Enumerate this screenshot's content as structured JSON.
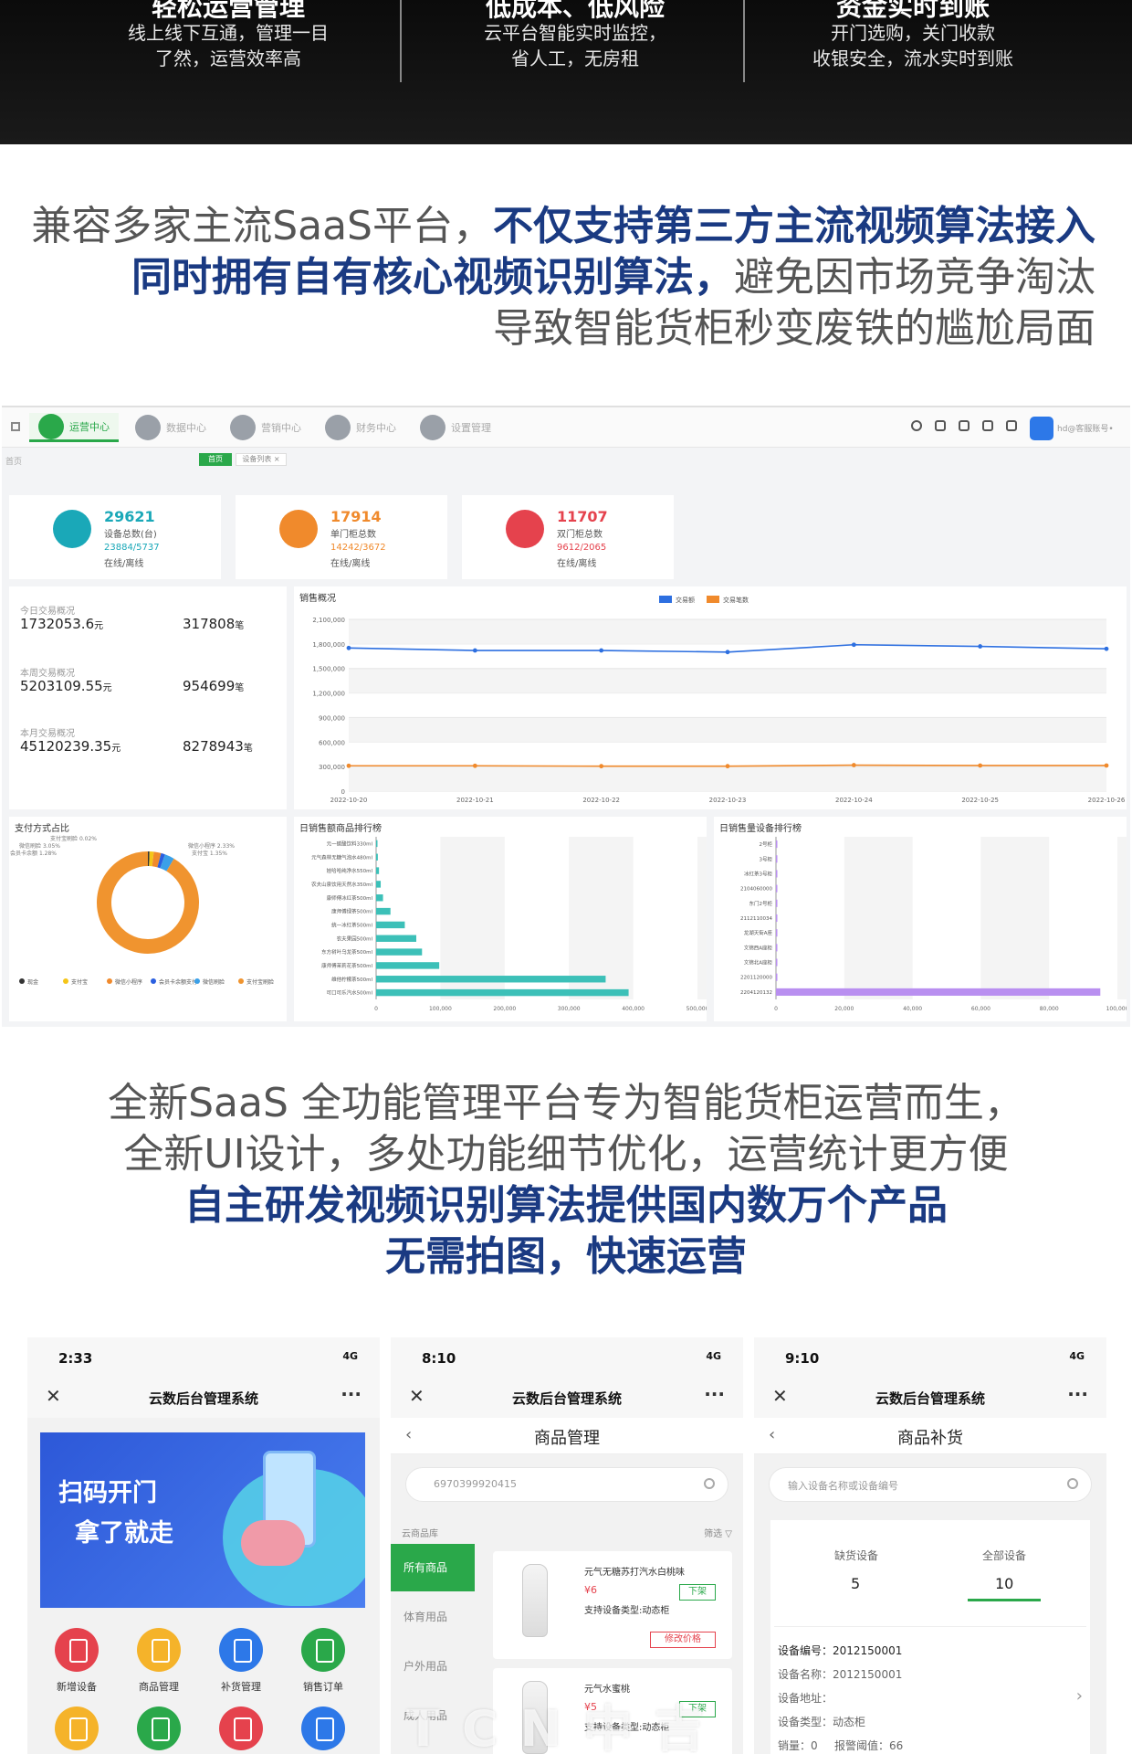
{
  "banner": {
    "columns": [
      {
        "title": "轻松运营管理",
        "lines": [
          "线上线下互通，管理一目",
          "了然，运营效率高"
        ]
      },
      {
        "title": "低成本、低风险",
        "lines": [
          "云平台智能实时监控，",
          "省人工，无房租"
        ]
      },
      {
        "title": "资金实时到账",
        "lines": [
          "开门选购，关门收款",
          "收银安全，流水实时到账"
        ]
      }
    ]
  },
  "headline1": {
    "line1_light": "兼容多家主流SaaS平台，",
    "line1_dark": "不仅支持第三方主流视频算法接入",
    "line2_dark": "同时拥有自有核心视频识别算法，",
    "line2_light": "避免因市场竞争淘汰",
    "line3_light": "导致智能货柜秒变废铁的尴尬局面"
  },
  "dashboard": {
    "nav": [
      "运营中心",
      "数据中心",
      "营销中心",
      "财务中心",
      "设置管理"
    ],
    "user": "hd@客服账号•",
    "crumb": "首页",
    "tag_green": "首页",
    "tag_white": "设备列表 ×",
    "stats": [
      {
        "value": "29621",
        "label": "设备总数(台)",
        "sub": "23884/5737",
        "sub_label": "在线/离线",
        "color": "#1aa8b8"
      },
      {
        "value": "17914",
        "label": "单门柜总数",
        "sub": "14242/3672",
        "sub_label": "在线/离线",
        "color": "#f08a2c"
      },
      {
        "value": "11707",
        "label": "双门柜总数",
        "sub": "9612/2065",
        "sub_label": "在线/离线",
        "color": "#e5424d"
      }
    ],
    "kv": [
      {
        "label": "今日交易概况",
        "amount": "1732053.6",
        "amount_unit": "元",
        "count": "317808",
        "count_unit": "笔"
      },
      {
        "label": "本周交易概况",
        "amount": "5203109.55",
        "amount_unit": "元",
        "count": "954699",
        "count_unit": "笔"
      },
      {
        "label": "本月交易概况",
        "amount": "45120239.35",
        "amount_unit": "元",
        "count": "8278943",
        "count_unit": "笔"
      }
    ],
    "panel_titles": {
      "sales": "销售概况",
      "payment": "支付方式占比",
      "product_rank": "日销售额商品排行榜",
      "device_rank": "日销售量设备排行榜"
    },
    "legend": {
      "s1": "交易额",
      "s2": "交易笔数"
    },
    "pie_legend": [
      "现金",
      "支付宝",
      "微信小程序",
      "会员卡余额支付",
      "微信刷脸",
      "支付宝刷脸"
    ],
    "pie_labels": [
      "支付宝刷脸 0.02%",
      "微信刷脸 3.05%",
      "会员卡余额 1.28%",
      "微信小程序 2.33%",
      "支付宝 1.35%"
    ]
  },
  "chart_data": [
    {
      "type": "line",
      "title": "销售概况",
      "x": [
        "2022-10-20",
        "2022-10-21",
        "2022-10-22",
        "2022-10-23",
        "2022-10-24",
        "2022-10-25",
        "2022-10-26"
      ],
      "series": [
        {
          "name": "交易额",
          "values": [
            1750000,
            1720000,
            1720000,
            1700000,
            1790000,
            1770000,
            1740000
          ],
          "color": "#2d6fe0"
        },
        {
          "name": "交易笔数",
          "values": [
            310000,
            310000,
            305000,
            305000,
            318000,
            313000,
            313000
          ],
          "color": "#f08a2c"
        }
      ],
      "ylim": [
        0,
        2100000
      ],
      "yticks": [
        "0",
        "300,000",
        "600,000",
        "900,000",
        "1,200,000",
        "1,500,000",
        "1,800,000",
        "2,100,000"
      ],
      "grid": true,
      "legend": "top"
    },
    {
      "type": "pie",
      "title": "支付方式占比",
      "labels": [
        "现金",
        "支付宝",
        "微信小程序",
        "会员卡余额支付",
        "微信刷脸",
        "支付宝刷脸"
      ],
      "values": [
        0.5,
        1.35,
        2.33,
        1.28,
        3.05,
        91.49
      ],
      "colors": [
        "#333333",
        "#f5c518",
        "#f08a2c",
        "#2a5fe0",
        "#3aa0e8",
        "#f0942f"
      ]
    },
    {
      "type": "bar",
      "title": "日销售额商品排行榜",
      "orientation": "horizontal",
      "categories": [
        "元一碳酸饮料330ml",
        "元气森林无糖气泡水480ml",
        "娃哈哈纯净水550ml",
        "农夫山泉饮用天然水350ml",
        "康师傅冰红茶500ml",
        "康师傅绿茶500ml",
        "统一冰红茶500ml",
        "农夫果园500ml",
        "东方树叶乌龙茶500ml",
        "康师傅茉莉花茶500ml",
        "维他柠檬茶500ml",
        "可口可乐汽水500ml"
      ],
      "values": [
        2000,
        3000,
        5000,
        8000,
        12000,
        25000,
        50000,
        70000,
        80000,
        110000,
        400000,
        440000
      ],
      "xlim": [
        0,
        560000
      ],
      "xticks": [
        "0",
        "100,000",
        "200,000",
        "300,000",
        "400,000",
        "500,000"
      ]
    },
    {
      "type": "bar",
      "title": "日销售量设备排行榜",
      "orientation": "horizontal",
      "categories": [
        "2号柜",
        "3号柜",
        "冰红茶3号柜",
        "2104060000",
        "东门2号柜",
        "2112110034",
        "龙湖天街A座",
        "文锦西A座柜",
        "文锦北A座柜",
        "2201120000",
        "2204120132"
      ],
      "values": [
        0,
        0,
        0,
        0,
        0,
        0,
        0,
        0,
        0,
        0,
        95000
      ],
      "xlim": [
        0,
        100000
      ],
      "xticks": [
        "0",
        "20,000",
        "40,000",
        "60,000",
        "80,000",
        "100,000"
      ]
    }
  ],
  "midtext": {
    "line1": "全新SaaS 全功能管理平台专为智能货柜运营而生，",
    "line2": "全新UI设计，多处功能细节优化，运营统计更方便",
    "line3": "自主研发视频识别算法提供国内数万个产品",
    "line4": "无需拍图，快速运营"
  },
  "phone1": {
    "time": "2:33",
    "signal": "4G",
    "title": "云数后台管理系统",
    "hero_line1": "扫码开门",
    "hero_line2": "拿了就走",
    "apps": [
      {
        "label": "新增设备",
        "color": "#e5424d"
      },
      {
        "label": "商品管理",
        "color": "#f5b32a"
      },
      {
        "label": "补货管理",
        "color": "#2d78e8"
      },
      {
        "label": "销售订单",
        "color": "#2aa84a"
      }
    ]
  },
  "phone2": {
    "time": "8:10",
    "signal": "4G",
    "title": "云数后台管理系统",
    "subtitle": "商品管理",
    "search_value": "6970399920415",
    "lib_label": "云商品库",
    "filter_label": "筛选 ▽",
    "categories": [
      "所有商品",
      "体育用品",
      "户外用品",
      "成人用品"
    ],
    "products": [
      {
        "name": "元气无糖苏打汽水白桃味",
        "price": "¥6",
        "type": "支持设备类型:动态柜",
        "btn": "下架",
        "btn2": "修改价格"
      },
      {
        "name": "元气水蜜桃",
        "price": "¥5",
        "type": "支持设备类型:动态柜",
        "btn": "下架"
      }
    ]
  },
  "phone3": {
    "time": "9:10",
    "signal": "4G",
    "title": "云数后台管理系统",
    "subtitle": "商品补货",
    "search_placeholder": "输入设备名称或设备编号",
    "tab1_label": "缺货设备",
    "tab1_value": "5",
    "tab2_label": "全部设备",
    "tab2_value": "10",
    "device_no": "设备编号：2012150001",
    "device_name": "设备名称：2012150001",
    "device_addr": "设备地址：",
    "device_type": "设备类型：动态柜",
    "stock": "销量：0",
    "alarm": "报警阈值：66"
  },
  "watermark": "TCN中吉"
}
